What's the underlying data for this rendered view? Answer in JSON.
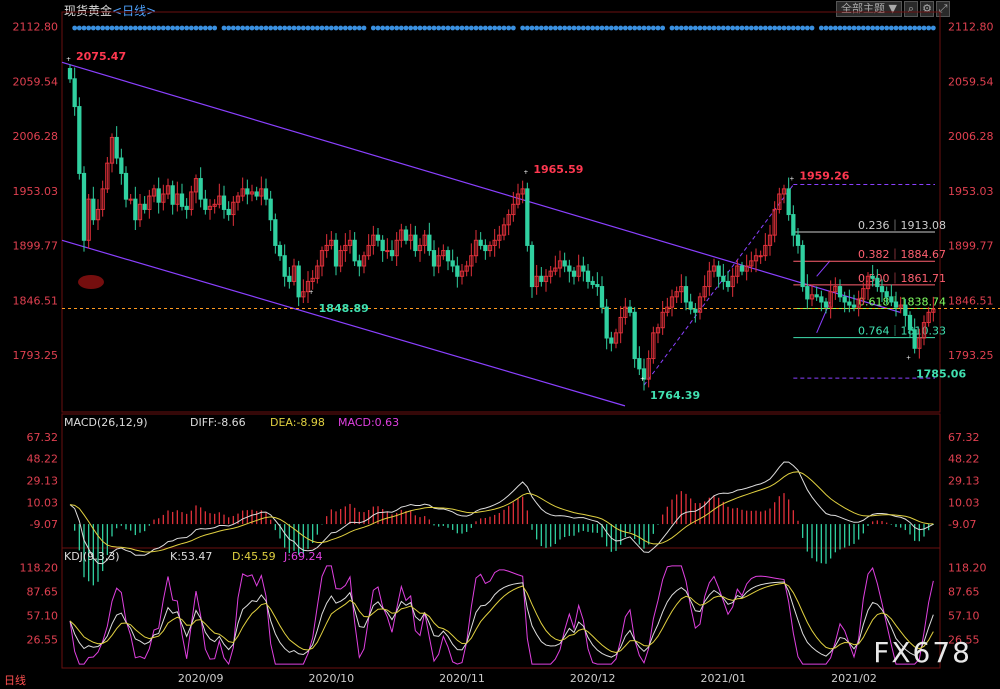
{
  "header": {
    "title": "现货黄金",
    "period_prefix": "<",
    "period": "日线",
    "period_suffix": ">"
  },
  "toolbar": {
    "theme_label": "全部主题",
    "theme_arrow": "▼"
  },
  "footer": {
    "mode": "日线"
  },
  "watermark": "FX678",
  "colors": {
    "up": "#e0303a",
    "down": "#30d0a0",
    "channel": "#8a40ff",
    "price_line": "#ff9a20",
    "grid": "#555"
  },
  "chart_data": {
    "type": "candlestick",
    "main": {
      "y_ticks": [
        2112.8,
        2059.54,
        2006.28,
        1953.03,
        1899.77,
        1846.51,
        1793.25
      ],
      "ylim": [
        1740,
        2125
      ],
      "annotations": [
        {
          "label": "2075.47",
          "i": 0,
          "price": 2075.47,
          "color": "up"
        },
        {
          "label": "1848.89",
          "i": 52,
          "price": 1848.89,
          "color": "down"
        },
        {
          "label": "1965.59",
          "i": 98,
          "price": 1965.59,
          "color": "up"
        },
        {
          "label": "1764.39",
          "i": 123,
          "price": 1764.39,
          "color": "down"
        },
        {
          "label": "1959.26",
          "i": 155,
          "price": 1959.26,
          "color": "up"
        },
        {
          "label": "1785.06",
          "i": 180,
          "price": 1785.06,
          "color": "down"
        }
      ],
      "fib": [
        {
          "label": "0.236｜1913.08",
          "price": 1913.08,
          "color": "#cccccc"
        },
        {
          "label": "0.382｜1884.67",
          "price": 1884.67,
          "color": "#ff6070"
        },
        {
          "label": "0.500｜1861.71",
          "price": 1861.71,
          "color": "#ff6070"
        },
        {
          "label": "0.618｜1838.74",
          "price": 1838.74,
          "color": "#80ff60"
        },
        {
          "label": "0.764｜1810.33",
          "price": 1810.33,
          "color": "#40e0b0"
        }
      ],
      "current_price": 1838.74
    },
    "macd": {
      "label": "MACD(26,12,9)",
      "diff": "DIFF:-8.66",
      "dea": "DEA:-8.98",
      "macd": "MACD:0.63",
      "y_ticks": [
        67.32,
        48.22,
        29.13,
        10.03,
        -9.07
      ]
    },
    "kdj": {
      "label": "KDJ(9,3,3)",
      "k": "K:53.47",
      "d": "D:45.59",
      "j": "J:69.24",
      "y_ticks": [
        118.2,
        87.65,
        57.1,
        26.55
      ]
    },
    "x_ticks": [
      {
        "label": "2020/09",
        "i": 28
      },
      {
        "label": "2020/10",
        "i": 56
      },
      {
        "label": "2020/11",
        "i": 84
      },
      {
        "label": "2020/12",
        "i": 112
      },
      {
        "label": "2021/01",
        "i": 140
      },
      {
        "label": "2021/02",
        "i": 168
      }
    ],
    "closes": [
      2062,
      2035,
      1970,
      1905,
      1945,
      1925,
      1935,
      1955,
      1980,
      2005,
      1985,
      1970,
      1945,
      1945,
      1925,
      1940,
      1935,
      1948,
      1955,
      1942,
      1950,
      1958,
      1940,
      1950,
      1938,
      1935,
      1952,
      1965,
      1945,
      1935,
      1938,
      1940,
      1948,
      1935,
      1930,
      1942,
      1948,
      1955,
      1950,
      1952,
      1948,
      1955,
      1945,
      1925,
      1900,
      1890,
      1870,
      1865,
      1880,
      1850,
      1855,
      1865,
      1868,
      1880,
      1895,
      1900,
      1905,
      1880,
      1895,
      1900,
      1905,
      1885,
      1880,
      1890,
      1900,
      1910,
      1905,
      1895,
      1895,
      1890,
      1905,
      1915,
      1905,
      1910,
      1895,
      1900,
      1910,
      1895,
      1880,
      1890,
      1895,
      1885,
      1880,
      1870,
      1875,
      1880,
      1890,
      1905,
      1900,
      1895,
      1900,
      1905,
      1910,
      1920,
      1930,
      1940,
      1950,
      1955,
      1900,
      1860,
      1870,
      1865,
      1870,
      1875,
      1878,
      1885,
      1880,
      1875,
      1870,
      1880,
      1875,
      1865,
      1862,
      1860,
      1840,
      1810,
      1805,
      1815,
      1830,
      1840,
      1835,
      1790,
      1780,
      1770,
      1790,
      1815,
      1820,
      1835,
      1840,
      1850,
      1855,
      1860,
      1845,
      1838,
      1835,
      1850,
      1860,
      1875,
      1880,
      1870,
      1865,
      1860,
      1870,
      1880,
      1875,
      1880,
      1885,
      1890,
      1890,
      1900,
      1910,
      1935,
      1950,
      1955,
      1930,
      1910,
      1900,
      1860,
      1848,
      1852,
      1850,
      1845,
      1840,
      1855,
      1860,
      1850,
      1845,
      1842,
      1840,
      1848,
      1858,
      1870,
      1868,
      1860,
      1855,
      1850,
      1845,
      1840,
      1842,
      1832,
      1818,
      1800,
      1810,
      1825,
      1835,
      1838
    ]
  }
}
